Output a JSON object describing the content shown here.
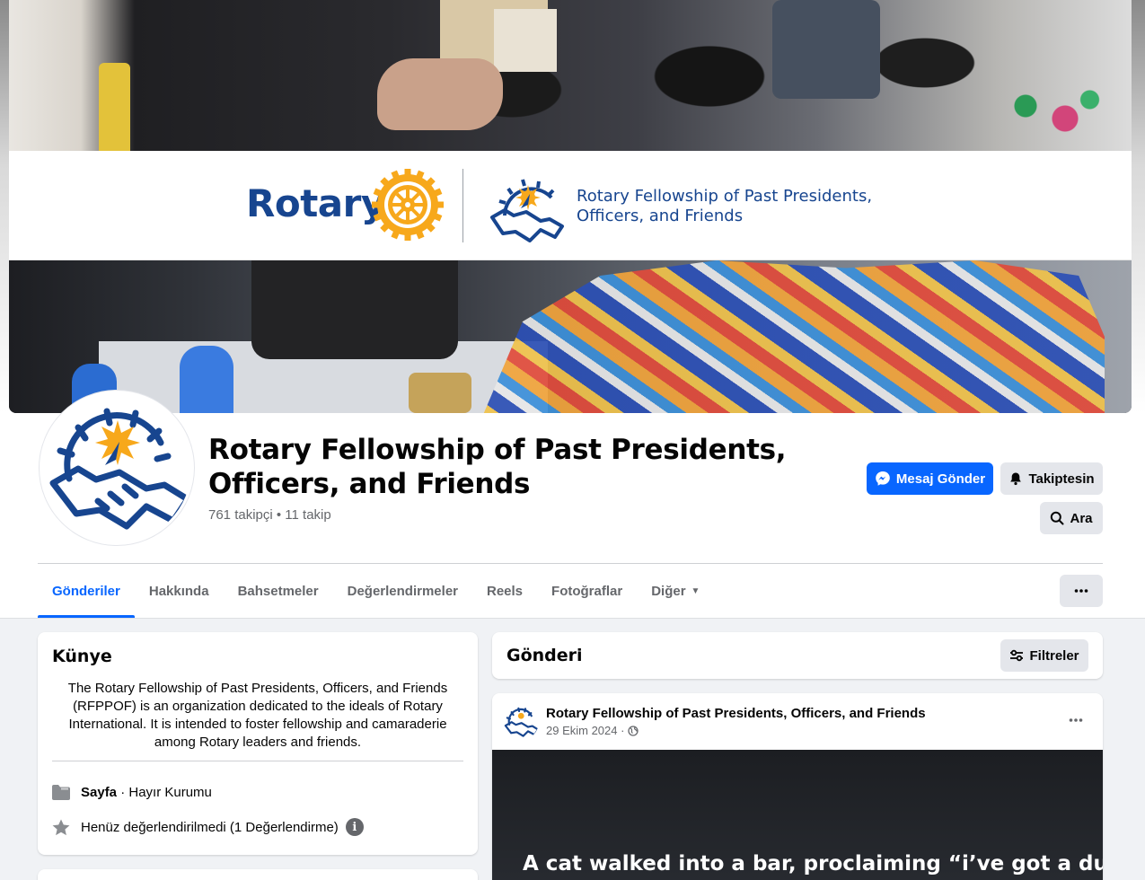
{
  "cover": {
    "banner_logo_text": "Rotary",
    "banner_text": "Rotary Fellowship of Past Presidents, Officers, and Friends"
  },
  "profile": {
    "name": "Rotary Fellowship of Past Presidents, Officers, and Friends",
    "stats": "761 takipçi • 11 takip"
  },
  "actions": {
    "message_label": "Mesaj Gönder",
    "following_label": "Takiptesin",
    "search_label": "Ara"
  },
  "tabs": [
    {
      "label": "Gönderiler",
      "active": true
    },
    {
      "label": "Hakkında"
    },
    {
      "label": "Bahsetmeler"
    },
    {
      "label": "Değerlendirmeler"
    },
    {
      "label": "Reels"
    },
    {
      "label": "Fotoğraflar"
    },
    {
      "label": "Diğer"
    }
  ],
  "intro": {
    "title": "Künye",
    "bio": "The Rotary Fellowship of Past Presidents, Officers, and Friends (RFPPOF) is an organization dedicated to the ideals of Rotary International. It is intended to foster fellowship and camaraderie among Rotary leaders and friends.",
    "page_type_bold": "Sayfa",
    "page_type_rest": " · Hayır Kurumu",
    "rating_text": "Henüz değerlendirilmedi (1 Değerlendirme)"
  },
  "posts": {
    "title": "Gönderi",
    "filter_label": "Filtreler"
  },
  "post": {
    "author": "Rotary Fellowship of Past Presidents, Officers, and Friends",
    "date": "29 Ekim 2024 ·",
    "media_text": "A cat walked into a bar, proclaiming “i’ve got a dumb-"
  },
  "colors": {
    "accent": "#0866ff",
    "rotary_blue": "#17458f",
    "rotary_gold": "#f7a81b"
  }
}
